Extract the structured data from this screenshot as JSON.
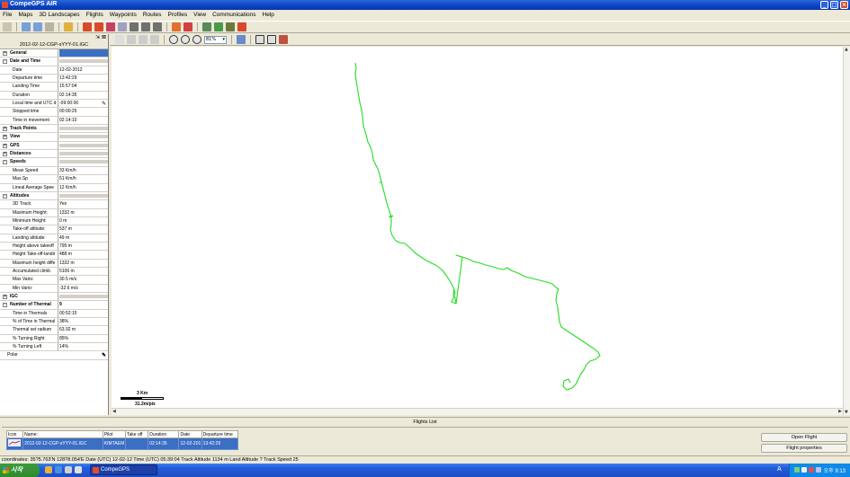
{
  "window": {
    "title": "CompeGPS AIR"
  },
  "menu": [
    "File",
    "Maps",
    "3D Landscapes",
    "Flights",
    "Waypoints",
    "Routes",
    "Profiles",
    "View",
    "Communications",
    "Help"
  ],
  "panel": {
    "filename": "2012-02-12-CGP-sYYY-01.IGC",
    "rows": [
      {
        "type": "section",
        "label": "General",
        "state": "+",
        "selected": true
      },
      {
        "type": "section",
        "label": "Date and Time",
        "state": "-"
      },
      {
        "type": "item",
        "label": "Date",
        "value": "12-02-2012"
      },
      {
        "type": "item",
        "label": "Departure time",
        "value": "13:42:29"
      },
      {
        "type": "item",
        "label": "Landing Time",
        "value": "15:57:04"
      },
      {
        "type": "item",
        "label": "Duration",
        "value": "02:14:35"
      },
      {
        "type": "item",
        "label": "Local time and UTC d",
        "value": "-09:00:00",
        "edit": true
      },
      {
        "type": "item",
        "label": "Stopped time",
        "value": "00:00:25"
      },
      {
        "type": "item",
        "label": "Time in movement",
        "value": "02:14:10"
      },
      {
        "type": "section",
        "label": "Track Points",
        "state": "+"
      },
      {
        "type": "section",
        "label": "View",
        "state": "+"
      },
      {
        "type": "section",
        "label": "GPS",
        "state": "+"
      },
      {
        "type": "section",
        "label": "Distances",
        "state": "+"
      },
      {
        "type": "section",
        "label": "Speeds",
        "state": "-"
      },
      {
        "type": "item",
        "label": "Mean Speed",
        "value": "33 Km/h"
      },
      {
        "type": "item",
        "label": "Max.Sp",
        "value": "51 Km/h"
      },
      {
        "type": "item",
        "label": "Lineal Average Spee",
        "value": "12 Km/h"
      },
      {
        "type": "section",
        "label": "Altitudes",
        "state": "-"
      },
      {
        "type": "item",
        "label": "3D Track:",
        "value": "Yes"
      },
      {
        "type": "item",
        "label": "Maximum Height:",
        "value": "1332 m"
      },
      {
        "type": "item",
        "label": "Minimum Height:",
        "value": "0 m"
      },
      {
        "type": "item",
        "label": "Take-off altitude:",
        "value": "537 m"
      },
      {
        "type": "item",
        "label": "Landing altitude:",
        "value": "49 m"
      },
      {
        "type": "item",
        "label": "Height above takeoff",
        "value": "795 m"
      },
      {
        "type": "item",
        "label": "Height Take-off-landir",
        "value": "488 m"
      },
      {
        "type": "item",
        "label": "Maximum height diffe",
        "value": "1332 m"
      },
      {
        "type": "item",
        "label": "Accumulated climb",
        "value": "5106 m"
      },
      {
        "type": "item",
        "label": "Max Vario:",
        "value": "30.5 m/s"
      },
      {
        "type": "item",
        "label": "Min Vario:",
        "value": "-32.6 m/s"
      },
      {
        "type": "section",
        "label": "IGC",
        "state": "+"
      },
      {
        "type": "section",
        "label": "Number of Thermal",
        "state": "-",
        "value": "9"
      },
      {
        "type": "item",
        "label": "Time in Thermals",
        "value": "00:52:15"
      },
      {
        "type": "item",
        "label": "% of Time in Thermal",
        "value": "38%"
      },
      {
        "type": "item",
        "label": "Thermal set radium",
        "value": "63.92 m"
      },
      {
        "type": "item",
        "label": "% Turning Right",
        "value": "85%"
      },
      {
        "type": "item",
        "label": "% Turning Left",
        "value": "14%"
      },
      {
        "type": "polar",
        "label": "Polar",
        "edit": true
      }
    ]
  },
  "map": {
    "zoom": "81%",
    "scale_distance": "3 Km",
    "scale_resolution": "31.2m/pix",
    "track_color": "#22dd22"
  },
  "flights_list": {
    "title": "Flights List",
    "columns": [
      "Icon",
      "Name:",
      "Pilot",
      "Take off",
      "Duration",
      "Date",
      "Departure time"
    ],
    "rows": [
      {
        "name": "2012-02-12-CGP-sYYY-01.IGC",
        "pilot": "KIMTAEM",
        "takeoff": "",
        "duration": "02:14:35",
        "date": "12-02-201",
        "departure": "13:42:29"
      }
    ],
    "open_button": "Open Flight",
    "properties_button": "Flight properties"
  },
  "status": "coordinates: 35?5.763'N 128?8.054'E  Date (UTC) 12-02-12  Time (UTC) 05:39:04 Track Altitude 1134 m  Land Altitude ?  Track Speed 25",
  "taskbar": {
    "start": "시작",
    "task": "CompeGPS",
    "lang": "A",
    "clock": "오후 9:13"
  }
}
